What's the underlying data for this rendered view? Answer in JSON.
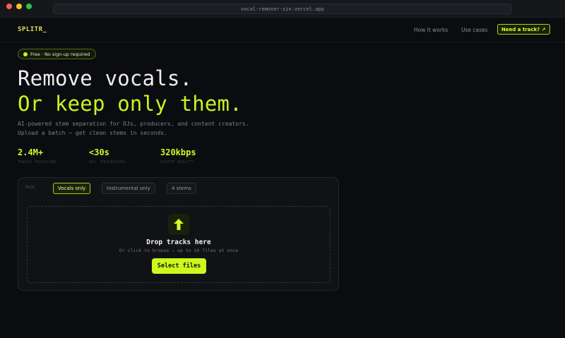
{
  "browser": {
    "url": "vocal-remover-sin.vercel.app"
  },
  "nav": {
    "logo": "SPLITR_",
    "links": [
      "How it works",
      "Use cases"
    ],
    "cta": "Need a track? ↗"
  },
  "hero": {
    "badge": "Free · No sign-up required",
    "headline_1": "Remove vocals.",
    "headline_2": "Or keep only them.",
    "subtitle_1": "AI-powered stem separation for DJs, producers, and content creators.",
    "subtitle_2": "Upload a batch — get clean stems in seconds.",
    "stats": [
      {
        "value": "2.4M+",
        "label": "TRACKS PROCESSED"
      },
      {
        "value": "<30s",
        "label": "AVG. PROCESSING"
      },
      {
        "value": "320kbps",
        "label": "OUTPUT QUALITY"
      }
    ]
  },
  "uploader": {
    "mode_label": "MODE",
    "modes": [
      "Vocals only",
      "Instrumental only",
      "4 stems"
    ],
    "selected_mode": "Vocals only",
    "drop_title": "Drop tracks here",
    "drop_subtitle": "Or click to browse — up to 10 files at once",
    "select_button": "Select files",
    "upload_icon": "arrow-up-icon"
  },
  "colors": {
    "background": "#0b0c10",
    "accent": "#cdf21f",
    "headline": "#ededed"
  }
}
